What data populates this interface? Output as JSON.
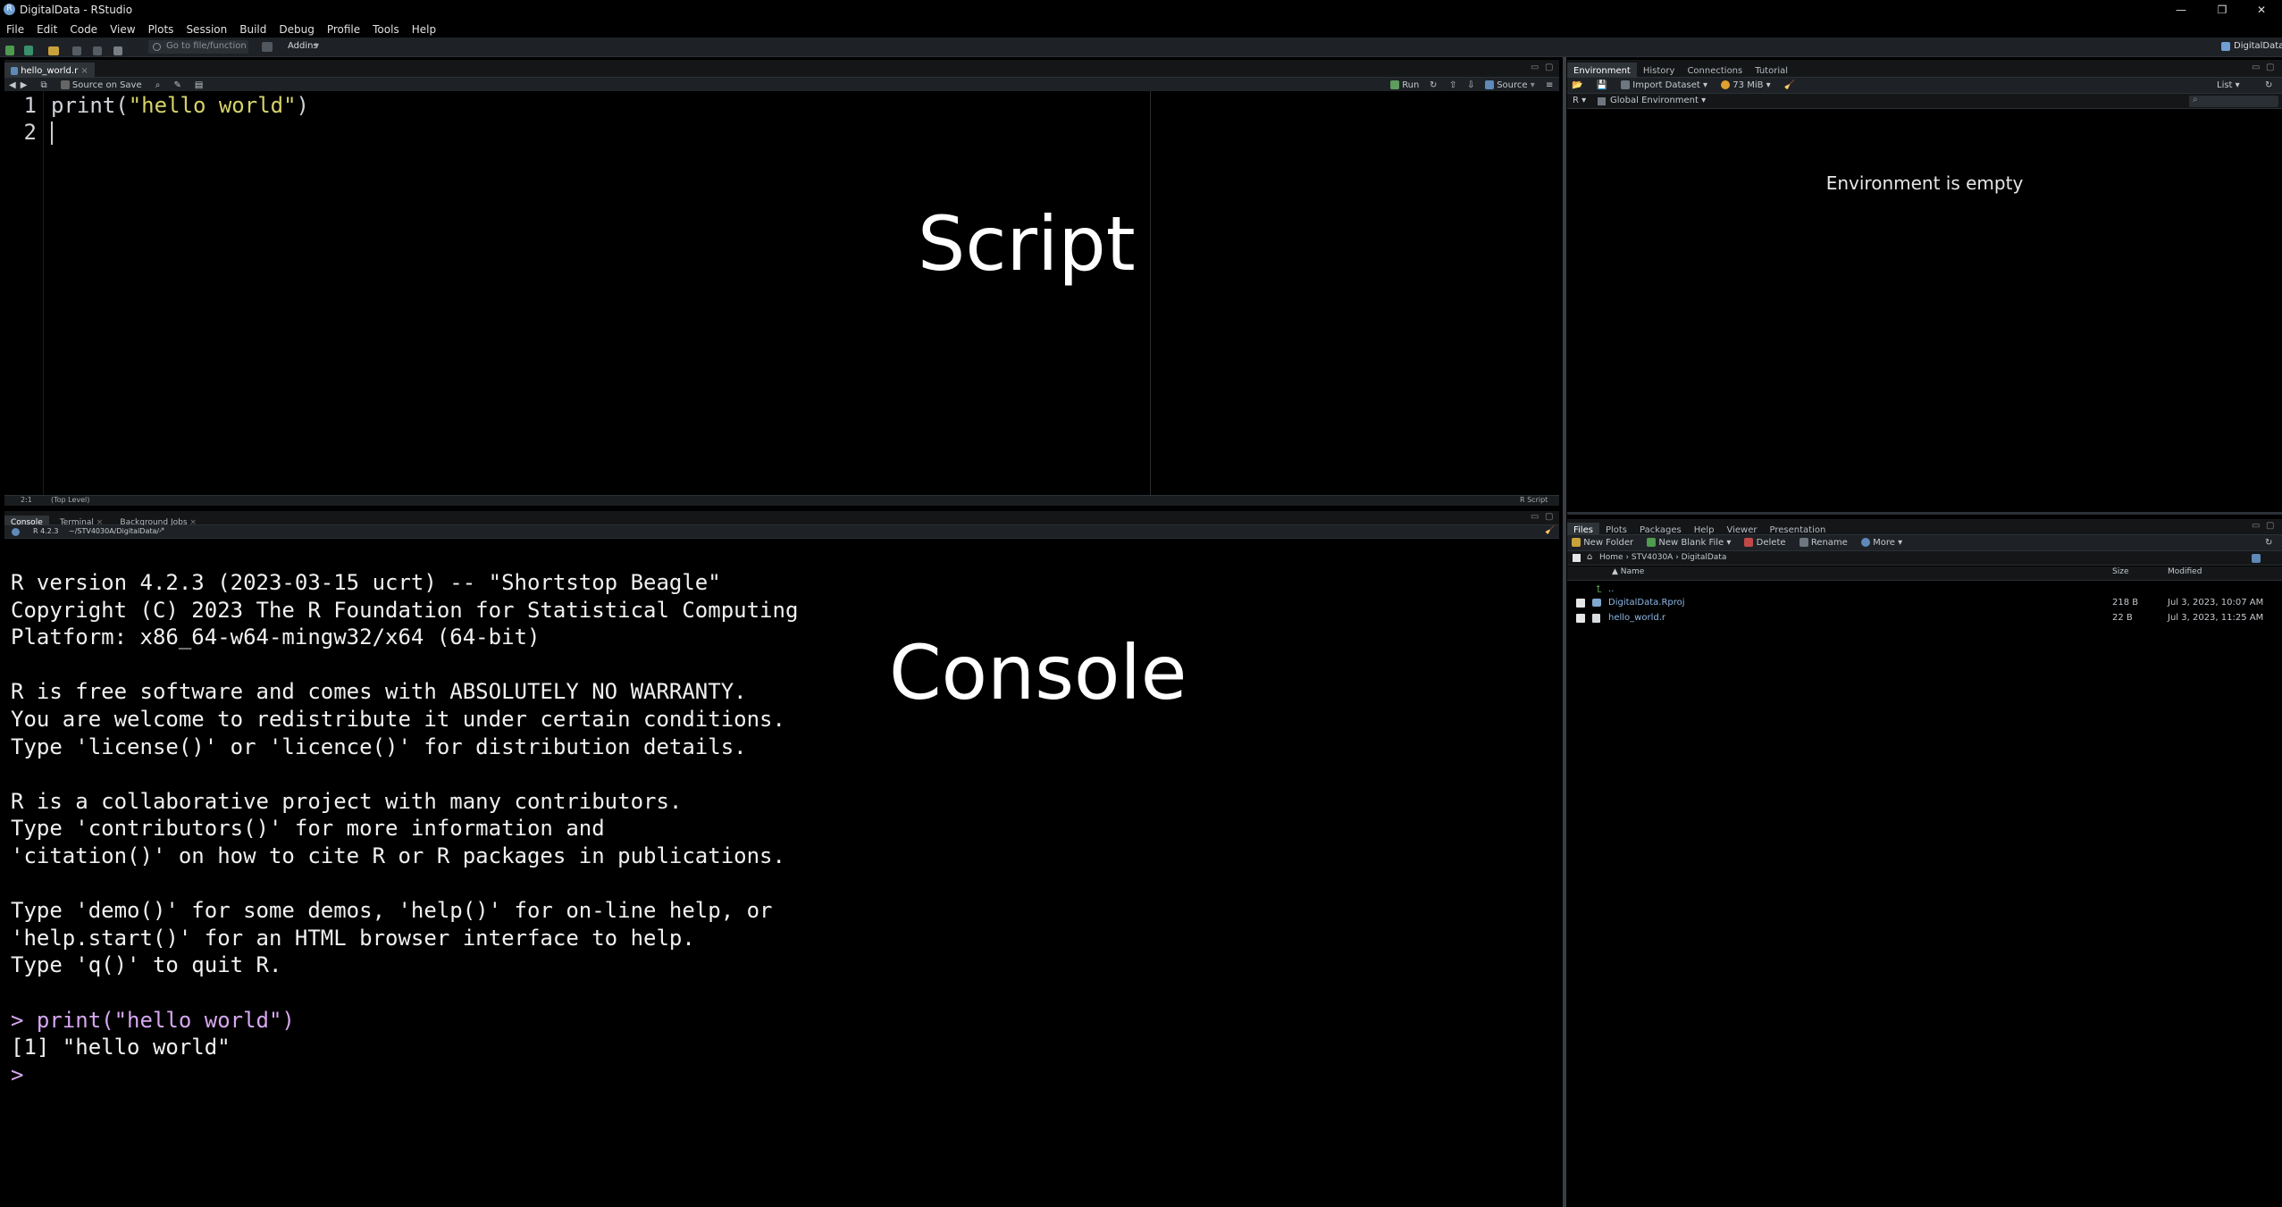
{
  "window": {
    "title": "DigitalData - RStudio",
    "logo_letter": "R",
    "controls": [
      "—",
      "❐",
      "✕"
    ]
  },
  "menu": [
    "File",
    "Edit",
    "Code",
    "View",
    "Plots",
    "Session",
    "Build",
    "Debug",
    "Profile",
    "Tools",
    "Help"
  ],
  "toolbar": {
    "goto_placeholder": "Go to file/function",
    "addins": "Addins",
    "project": "DigitalData"
  },
  "source": {
    "tab": "hello_world.r",
    "source_on_save": "Source on Save",
    "run": "Run",
    "source": "Source",
    "lines": [
      "1",
      "2"
    ],
    "code": {
      "fn": "print(",
      "str": "\"hello world\"",
      "close": ")"
    },
    "status_pos": "2:1",
    "status_scope": "(Top Level)",
    "status_lang": "R Script",
    "overlay": "Script"
  },
  "console": {
    "tabs": [
      "Console",
      "Terminal",
      "Background Jobs"
    ],
    "r_version": "R 4.2.3",
    "path": "~/STV4030A/DigitalData/",
    "lines": [
      "R version 4.2.3 (2023-03-15 ucrt) -- \"Shortstop Beagle\"",
      "Copyright (C) 2023 The R Foundation for Statistical Computing",
      "Platform: x86_64-w64-mingw32/x64 (64-bit)",
      "",
      "R is free software and comes with ABSOLUTELY NO WARRANTY.",
      "You are welcome to redistribute it under certain conditions.",
      "Type 'license()' or 'licence()' for distribution details.",
      "",
      "R is a collaborative project with many contributors.",
      "Type 'contributors()' for more information and",
      "'citation()' on how to cite R or R packages in publications.",
      "",
      "Type 'demo()' for some demos, 'help()' for on-line help, or",
      "'help.start()' for an HTML browser interface to help.",
      "Type 'q()' to quit R.",
      ""
    ],
    "command": "> print(\"hello world\")",
    "output": "[1] \"hello world\"",
    "prompt": ">",
    "overlay": "Console"
  },
  "environment": {
    "tabs": [
      "Environment",
      "History",
      "Connections",
      "Tutorial"
    ],
    "import_dataset": "Import Dataset",
    "memory": "73 MiB",
    "list": "List",
    "r_lang": "R",
    "scope": "Global Environment",
    "empty_msg": "Environment is empty"
  },
  "files": {
    "tabs": [
      "Files",
      "Plots",
      "Packages",
      "Help",
      "Viewer",
      "Presentation"
    ],
    "new_folder": "New Folder",
    "new_blank_file": "New Blank File",
    "delete": "Delete",
    "rename": "Rename",
    "more": "More",
    "breadcrumb": [
      "Home",
      "STV4030A",
      "DigitalData"
    ],
    "columns": {
      "name": "Name",
      "size": "Size",
      "modified": "Modified"
    },
    "up": "..",
    "rows": [
      {
        "name": "DigitalData.Rproj",
        "size": "218 B",
        "modified": "Jul 3, 2023, 10:07 AM"
      },
      {
        "name": "hello_world.r",
        "size": "22 B",
        "modified": "Jul 3, 2023, 11:25 AM"
      }
    ]
  },
  "colors": {
    "accent": "#6fa0d3",
    "string": "#d6d26a",
    "command": "#d6a7f0"
  }
}
